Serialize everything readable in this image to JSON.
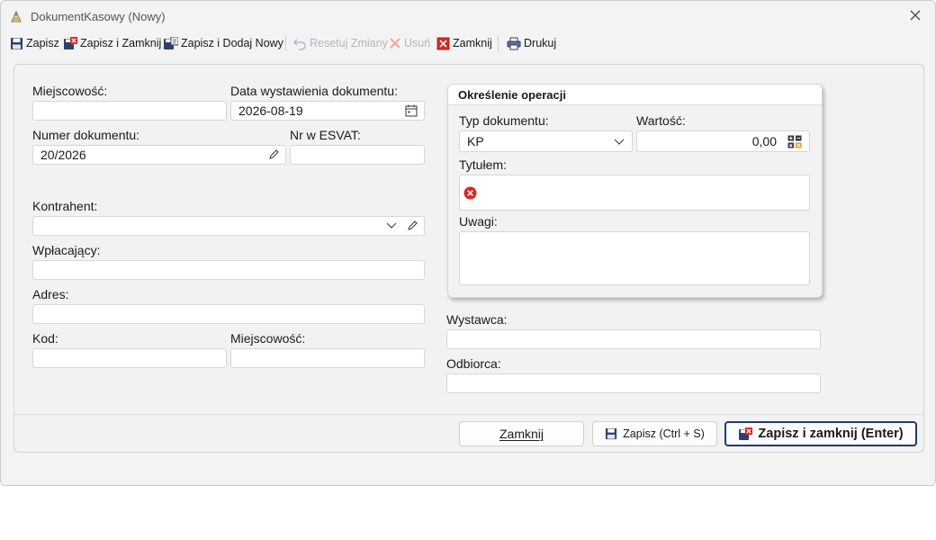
{
  "window": {
    "title": "DokumentKasowy (Nowy)"
  },
  "toolbar": {
    "save": "Zapisz",
    "save_close": "Zapisz i Zamknij",
    "save_new": "Zapisz i Dodaj Nowy",
    "reset": "Resetuj Zmiany",
    "delete": "Usuń",
    "close": "Zamknij",
    "print": "Drukuj"
  },
  "form": {
    "city_label": "Miejscowość:",
    "city_value": "",
    "issue_date_label": "Data wystawienia dokumentu:",
    "issue_date_value": "2026-08-19",
    "doc_number_label": "Numer dokumentu:",
    "doc_number_value": "20/2026",
    "esvat_label": "Nr w ESVAT:",
    "esvat_value": "",
    "contractor_label": "Kontrahent:",
    "contractor_value": "",
    "payer_label": "Wpłacający:",
    "payer_value": "",
    "address_label": "Adres:",
    "address_value": "",
    "postal_code_label": "Kod:",
    "postal_code_value": "",
    "city2_label": "Miejscowość:",
    "city2_value": "",
    "issuer_label": "Wystawca:",
    "issuer_value": "",
    "receiver_label": "Odbiorca:",
    "receiver_value": ""
  },
  "operation": {
    "title": "Określenie operacji",
    "doc_type_label": "Typ dokumentu:",
    "doc_type_value": "KP",
    "amount_label": "Wartość:",
    "amount_value": "0,00",
    "subject_label": "Tytułem:",
    "notes_label": "Uwagi:"
  },
  "buttons": {
    "close": "Zamknij",
    "save": "Zapisz (Ctrl + S)",
    "save_close": "Zapisz i zamknij (Enter)"
  },
  "colors": {
    "error": "#e02424",
    "primary_border": "#1f3b6e",
    "disk_icon": "#2d3f6b"
  }
}
